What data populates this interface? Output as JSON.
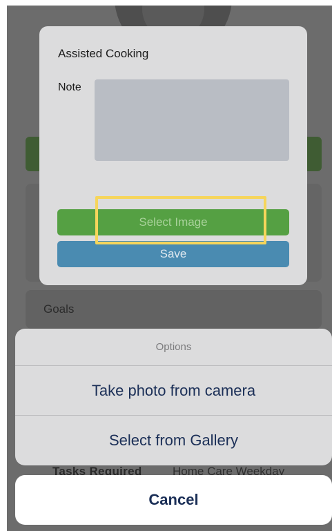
{
  "background": {
    "goals_label": "Goals",
    "tasks_label": "Tasks Required",
    "tasks_value": "Home Care Weekday"
  },
  "dialog": {
    "title": "Assisted Cooking",
    "note_label": "Note",
    "note_value": "",
    "select_image_label": "Select Image",
    "save_label": "Save"
  },
  "action_sheet": {
    "title": "Options",
    "items": [
      {
        "label": "Take photo from camera"
      },
      {
        "label": "Select from Gallery"
      }
    ],
    "cancel_label": "Cancel"
  },
  "colors": {
    "select_button": "#55a043",
    "save_button": "#4a8bb1",
    "highlight": "#f6d55b",
    "sheet_text": "#1b2f57"
  }
}
